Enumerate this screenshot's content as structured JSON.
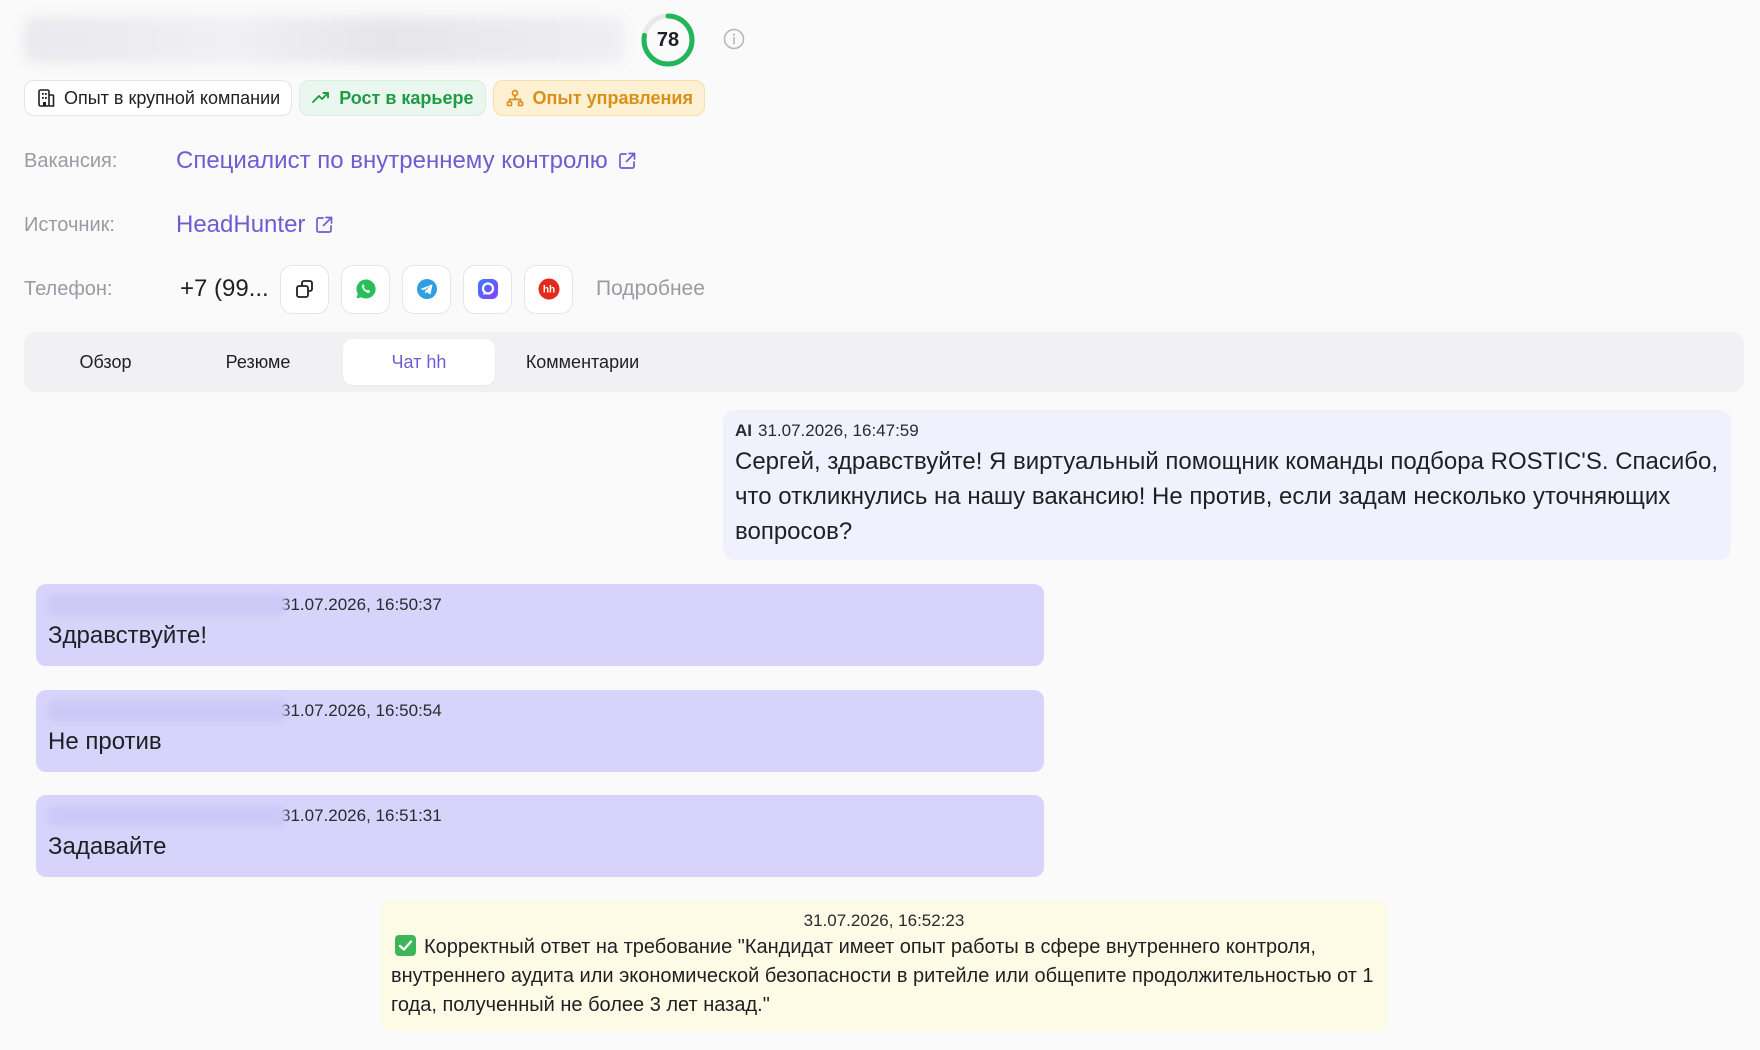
{
  "candidate": {
    "score": "78",
    "score_fraction": 0.78,
    "score_color": "#22b55a"
  },
  "tags": [
    {
      "label": "Опыт в крупной компании",
      "icon": "building-icon"
    },
    {
      "label": "Рост в карьере",
      "icon": "trend-up-icon"
    },
    {
      "label": "Опыт управления",
      "icon": "org-chart-icon"
    }
  ],
  "details": {
    "vacancy_label": "Вакансия:",
    "vacancy_value": "Специалист по внутреннему контролю",
    "source_label": "Источник:",
    "source_value": "HeadHunter",
    "phone_label": "Телефон:",
    "phone_value": "+7 (99...",
    "more_label": "Подробнее"
  },
  "phone_actions": [
    "copy-icon",
    "whatsapp-icon",
    "telegram-icon",
    "max-messenger-icon",
    "headhunter-icon"
  ],
  "tabs": [
    {
      "label": "Обзор",
      "active": false
    },
    {
      "label": "Резюме",
      "active": false
    },
    {
      "label": "Чат hh",
      "active": true
    },
    {
      "label": "Комментарии",
      "active": false
    }
  ],
  "chat": {
    "ai_message": {
      "sender": "AI",
      "time": "31.07.2026, 16:47:59",
      "text": "Сергей, здравствуйте! Я виртуальный помощник команды подбора ROSTIC'S. Спасибо, что откликнулись на нашу вакансию! Не против, если задам несколько уточняющих вопросов?"
    },
    "user_messages": [
      {
        "time": "31.07.2026, 16:50:37",
        "text": "Здравствуйте!"
      },
      {
        "time": "31.07.2026, 16:50:54",
        "text": "Не против"
      },
      {
        "time": "31.07.2026, 16:51:31",
        "text": "Задавайте"
      }
    ],
    "evaluation": {
      "time": "31.07.2026, 16:52:23",
      "text": "Корректный ответ на требование \"Кандидат имеет опыт работы в сфере внутреннего контроля, внутреннего аудита или экономической безопасности в ритейле или общепите продолжительностью от 1 года, полученный не более 3 лет назад.\""
    }
  },
  "colors": {
    "accent": "#6d5dd3",
    "user_bubble": "#d7d3fb",
    "ai_bubble": "#f1f0fd",
    "evaluation_bubble": "#fdfbe6"
  }
}
